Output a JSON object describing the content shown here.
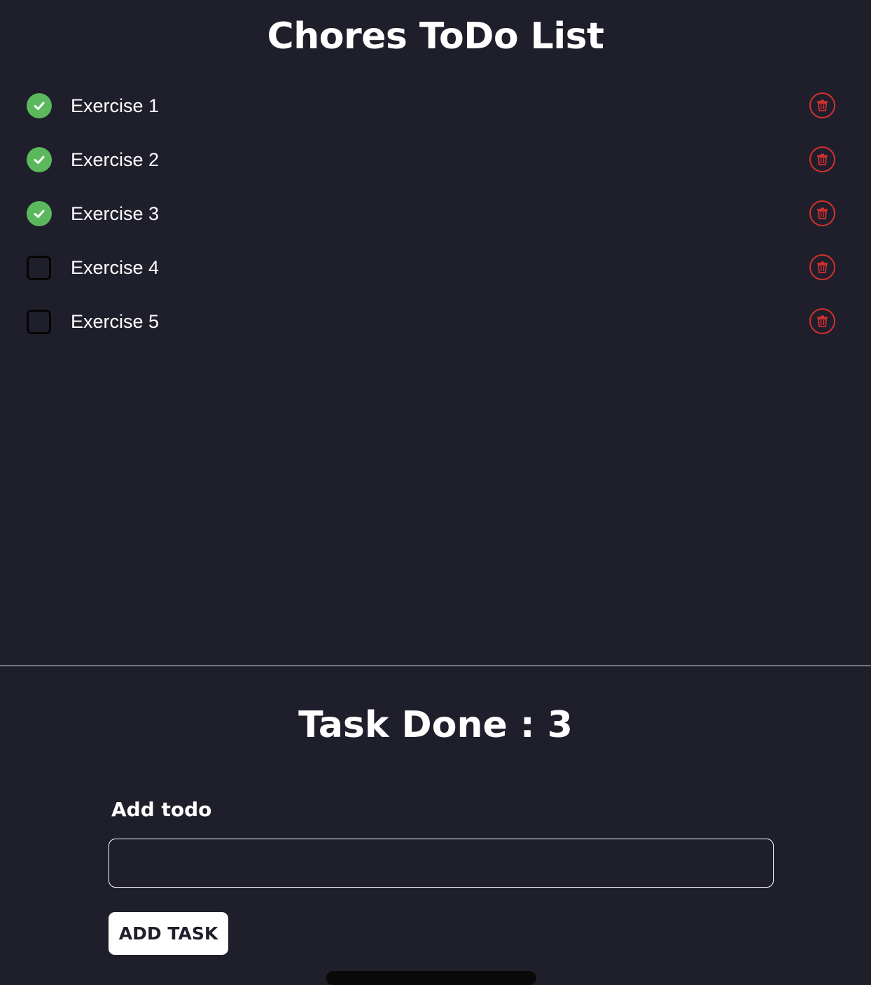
{
  "header": {
    "title": "Chores ToDo List"
  },
  "todos": [
    {
      "label": "Exercise 1",
      "done": true
    },
    {
      "label": "Exercise 2",
      "done": true
    },
    {
      "label": "Exercise 3",
      "done": true
    },
    {
      "label": "Exercise 4",
      "done": false
    },
    {
      "label": "Exercise 5",
      "done": false
    }
  ],
  "summary": {
    "task_done_text": "Task Done : 3"
  },
  "form": {
    "label": "Add todo",
    "input_value": "",
    "button_label": "ADD TASK"
  },
  "colors": {
    "background": "#1e1f2b",
    "done_green": "#5cb85c",
    "delete_red": "#d32f2f",
    "text": "#ffffff"
  },
  "icons": {
    "done": "check-circle-icon",
    "todo": "empty-checkbox-icon",
    "delete": "trash-icon"
  }
}
